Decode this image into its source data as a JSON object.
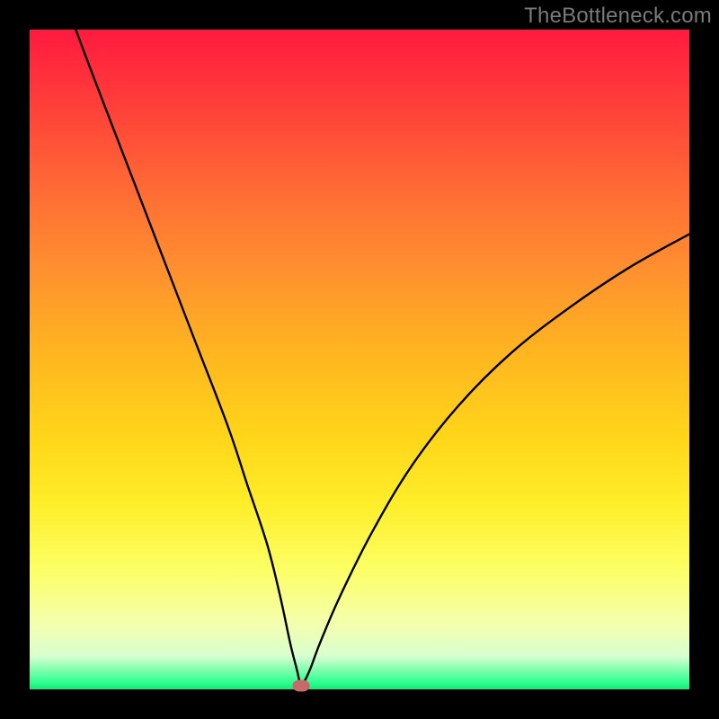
{
  "watermark": "TheBottleneck.com",
  "chart_data": {
    "type": "line",
    "title": "",
    "xlabel": "",
    "ylabel": "",
    "xlim": [
      0,
      100
    ],
    "ylim": [
      0,
      100
    ],
    "grid": false,
    "series": [
      {
        "name": "curve",
        "x": [
          7,
          10,
          15,
          20,
          25,
          30,
          33,
          36,
          38,
          39.5,
          40.5,
          41,
          41.5,
          42.5,
          44,
          47,
          52,
          58,
          65,
          73,
          82,
          91,
          100
        ],
        "values": [
          100,
          92,
          79,
          66,
          53,
          40,
          31,
          22,
          14,
          7,
          3,
          1,
          1,
          3,
          7,
          14,
          24,
          34,
          43,
          51,
          58,
          64,
          69
        ]
      }
    ],
    "annotations": [
      {
        "type": "marker",
        "shape": "pill",
        "x": 41.2,
        "y": 0.6,
        "color": "#c96a6a"
      }
    ],
    "background": {
      "type": "vertical-gradient",
      "stops": [
        {
          "pos": 0,
          "color": "#ff1a3f"
        },
        {
          "pos": 50,
          "color": "#ffb81f"
        },
        {
          "pos": 82,
          "color": "#fcff66"
        },
        {
          "pos": 99,
          "color": "#2cff8f"
        },
        {
          "pos": 100,
          "color": "#17e876"
        }
      ]
    }
  }
}
